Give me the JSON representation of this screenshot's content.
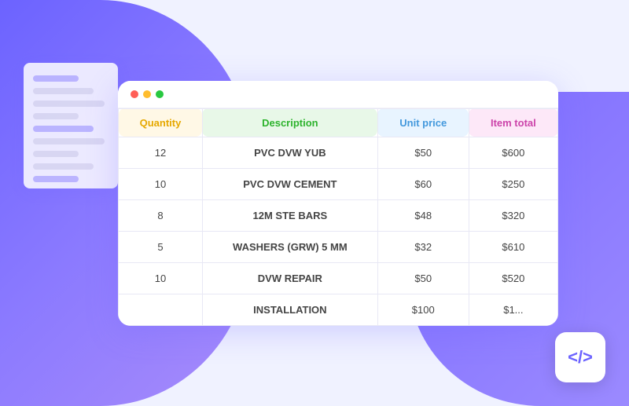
{
  "window": {
    "dots": [
      "red",
      "yellow",
      "green"
    ]
  },
  "table": {
    "headers": {
      "quantity": "Quantity",
      "description": "Description",
      "unit_price": "Unit price",
      "item_total": "Item total"
    },
    "rows": [
      {
        "quantity": "12",
        "description": "PVC DVW YUB",
        "unit_price": "$50",
        "item_total": "$600"
      },
      {
        "quantity": "10",
        "description": "PVC DVW CEMENT",
        "unit_price": "$60",
        "item_total": "$250"
      },
      {
        "quantity": "8",
        "description": "12M STE BARS",
        "unit_price": "$48",
        "item_total": "$320"
      },
      {
        "quantity": "5",
        "description": "WASHERS (GRW) 5 MM",
        "unit_price": "$32",
        "item_total": "$610"
      },
      {
        "quantity": "10",
        "description": "DVW REPAIR",
        "unit_price": "$50",
        "item_total": "$520"
      },
      {
        "quantity": "",
        "description": "INSTALLATION",
        "unit_price": "$100",
        "item_total": "$1..."
      }
    ]
  },
  "code_badge": {
    "icon": "</>",
    "label": "code-icon"
  }
}
